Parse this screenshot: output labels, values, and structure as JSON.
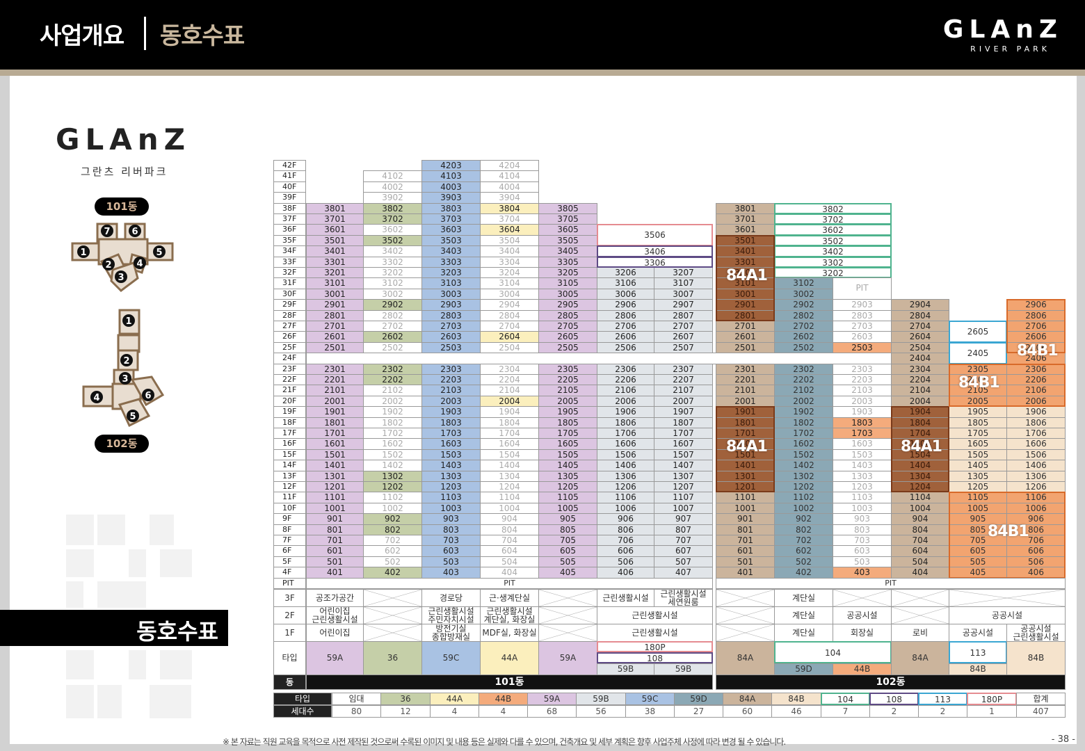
{
  "header": {
    "title": "사업개요",
    "subtitle": "동호수표",
    "logo": "GLAnZ",
    "logo_sub": "RIVER PARK"
  },
  "brand": {
    "logo": "GLAnZ",
    "name_kr": "그란츠 리버파크"
  },
  "building_labels": {
    "b101": "101동",
    "b102": "102동"
  },
  "section_tag": "동호수표",
  "site_plan_markers": {
    "b101": [
      "1",
      "2",
      "3",
      "4",
      "5",
      "6",
      "7"
    ],
    "b102": [
      "1",
      "2",
      "3",
      "4",
      "5",
      "6"
    ]
  },
  "colors": {
    "59A": "#dcc5e1",
    "36": "#c5cfa8",
    "59C": "#a9c2e3",
    "44A": "#fbefbd",
    "44B": "#f4ab7c",
    "59B": "#e1e5e9",
    "59D": "#8ba8b5",
    "84A": "#cbb49c",
    "84B": "#f5e3cc",
    "84A1": "#a0613b",
    "84B1": "#f2a470",
    "white": "#ffffff",
    "104": "#4fb38e",
    "108": "#5e4b85",
    "113": "#3aa6d2",
    "180P": "#e58b90",
    "header": "#000000"
  },
  "floors": [
    "42F",
    "41F",
    "40F",
    "39F",
    "38F",
    "37F",
    "36F",
    "35F",
    "34F",
    "33F",
    "32F",
    "31F",
    "30F",
    "29F",
    "28F",
    "27F",
    "26F",
    "25F",
    "24F",
    "23F",
    "22F",
    "21F",
    "20F",
    "19F",
    "18F",
    "17F",
    "16F",
    "15F",
    "14F",
    "13F",
    "12F",
    "11F",
    "10F",
    "9F",
    "8F",
    "7F",
    "6F",
    "5F",
    "4F"
  ],
  "pit_label": "PIT",
  "pit_cells": {
    "31F": "PIT"
  },
  "labels_84": [
    "84A1",
    "84A1",
    "84A1",
    "84B1",
    "84B1",
    "84B1"
  ],
  "merged_units": {
    "3506": "3506",
    "3406": "3406",
    "3306": "3306",
    "3802": "3802",
    "3702": "3702",
    "3602": "3602",
    "3502": "3502",
    "3402": "3402",
    "3302": "3302",
    "3202": "3202",
    "2605": "2605",
    "2405": "2405"
  },
  "facility_rows": {
    "floors": [
      "3F",
      "2F",
      "1F"
    ],
    "b101": {
      "c1": [
        "공조가공간",
        "어린이집\n근린생활시설",
        "어린이집"
      ],
      "c3": [
        "경로당",
        "근린생활시설\n주민자치시설",
        "방전기실\n종합방재실"
      ],
      "c4": [
        "근·생계단실",
        "근린생활시설\n계단실, 화장실",
        "MDF실, 화장실"
      ],
      "c67": [
        "근린생활시설",
        "근린생활시설",
        "근린생활시설"
      ],
      "c7_3F": "근린생활시설\n세연원룸"
    },
    "b102": {
      "c2": [
        "계단실",
        "계단실",
        "계단실"
      ],
      "c3": [
        "",
        "공공시설",
        "회장실"
      ],
      "c4_1F": "로비",
      "c56_2F": "공공시설",
      "c5_1F": "공공시설",
      "c6_1F": "공공시설\n근린생활시설"
    }
  },
  "type_row": {
    "label": "타입",
    "b101": [
      "59A",
      "36",
      "59C",
      "44A",
      "59A",
      "180P",
      "108",
      "59B",
      "59B"
    ],
    "b102": [
      "84A",
      "104",
      "59D",
      "44B",
      "84A",
      "113",
      "84B",
      "84B"
    ]
  },
  "dong_row": {
    "label": "동",
    "b101": "101동",
    "b102": "102동"
  },
  "legend": {
    "type_label": "타입",
    "count_label": "세대수",
    "types": [
      "임대",
      "36",
      "44A",
      "44B",
      "59A",
      "59B",
      "59C",
      "59D",
      "84A",
      "84B",
      "104",
      "108",
      "113",
      "180P",
      "합계"
    ],
    "counts": [
      "80",
      "12",
      "4",
      "4",
      "68",
      "56",
      "38",
      "27",
      "60",
      "46",
      "7",
      "2",
      "2",
      "1",
      "407"
    ]
  },
  "footer": {
    "disclaimer": "※ 본 자료는 직원 교육을 목적으로 사전 제작된 것으로써 수록된 이미지 및 내용 등은 실제와 다를 수 있으며, 건축개요 및 세부 계획은 향후 사업주체 사정에 따라 변경 될 수 있습니다.",
    "page": "- 38 -"
  }
}
